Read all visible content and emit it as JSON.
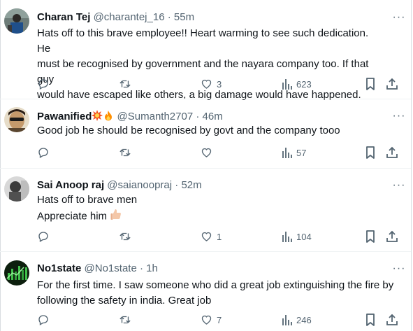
{
  "tweets": [
    {
      "name": "Charan Tej",
      "handle": "@charantej_16",
      "time": "55m",
      "lines": [
        "Hats off to this brave employee!! Heart warming to see such dedication. He",
        "must be recognised by government and the nayara company too. If that guy",
        "would have escaped like others, a big damage would have happened."
      ],
      "replies": "",
      "retweets": "",
      "likes": "3",
      "views": "623",
      "avatar_color": "#4a5a58"
    },
    {
      "name": "Pawanified",
      "handle": "@Sumanth2707",
      "time": "46m",
      "lines": [
        "Good job he should be recognised by govt and the company tooo"
      ],
      "replies": "",
      "retweets": "",
      "likes": "",
      "views": "57",
      "avatar_color": "#c9b79a"
    },
    {
      "name": "Sai Anoop raj",
      "handle": "@saianoopraj",
      "time": "52m",
      "lines": [
        "Hats off to brave men",
        "Appreciate him"
      ],
      "replies": "",
      "retweets": "",
      "likes": "1",
      "views": "104",
      "avatar_color": "#8a8a8a"
    },
    {
      "name": "No1state",
      "handle": "@No1state",
      "time": "1h",
      "lines": [
        "For the first time. I saw someone who did a great job extinguishing the fire by",
        "following the safety in india. Great job"
      ],
      "replies": "",
      "retweets": "",
      "likes": "7",
      "views": "246",
      "avatar_color": "#0f2a10"
    }
  ],
  "sep": "·",
  "more_glyph": "···",
  "colors": {
    "text": "#0f1419",
    "muted": "#536471",
    "divider": "#eff3f4"
  }
}
